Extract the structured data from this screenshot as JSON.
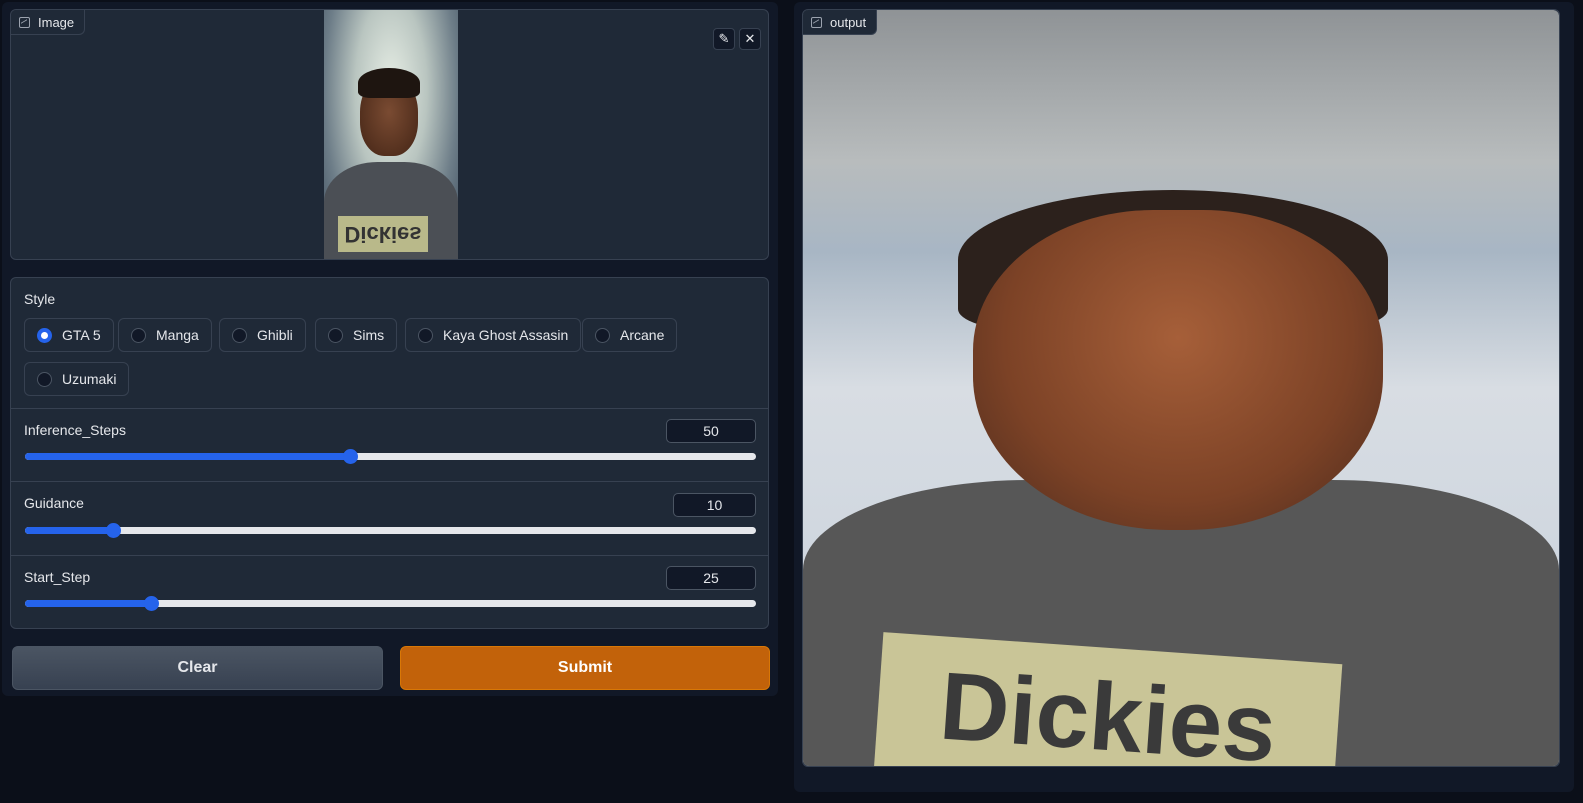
{
  "input_panel": {
    "label": "Image",
    "edit_icon": "pencil-icon",
    "close_icon": "close-icon",
    "shirt_print_text": "Dickies"
  },
  "style": {
    "label": "Style",
    "options": [
      "GTA 5",
      "Manga",
      "Ghibli",
      "Sims",
      "Kaya Ghost Assasin",
      "Arcane",
      "Uzumaki"
    ],
    "selected": "GTA 5"
  },
  "sliders": [
    {
      "label": "Inference_Steps",
      "value": "50",
      "fraction": 0.445
    },
    {
      "label": "Guidance",
      "value": "10",
      "fraction": 0.12
    },
    {
      "label": "Start_Step",
      "value": "25",
      "fraction": 0.173
    }
  ],
  "buttons": {
    "clear": "Clear",
    "submit": "Submit"
  },
  "output_panel": {
    "label": "output",
    "shirt_print_text": "Dickies"
  },
  "colors": {
    "accent": "#2563eb",
    "submit": "#c2620a",
    "background": "#0b0f19",
    "panel": "#1f2937"
  }
}
